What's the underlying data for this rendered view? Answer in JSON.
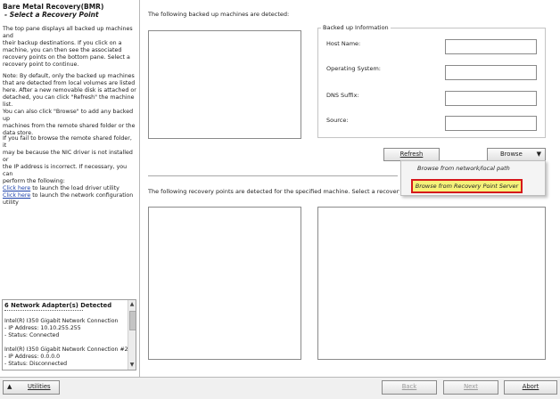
{
  "left": {
    "title": "Bare Metal Recovery(BMR)",
    "subtitle": "- Select a Recovery Point",
    "para1": [
      "The top pane displays all backed up machines and",
      "their backup destinations. If you click on a",
      "machine, you can then see the associated",
      "recovery points on the bottom pane. Select a",
      "recovery point to continue."
    ],
    "para2": [
      "Note: By default, only the backed up machines",
      "that are detected from local volumes are listed",
      "here. After a new removable disk is attached or",
      "detached, you can click \"Refresh\" the machine list.",
      "You can also click \"Browse\" to add any backed up",
      "machines from the remote shared folder or the",
      "data store."
    ],
    "para3": [
      "If you fail to browse the remote shared folder, it",
      "may be because the NIC driver is not installed or",
      "the IP address is incorrect. If necessary, you can",
      "perform the following:"
    ],
    "link1": "Click here",
    "link1_rest": " to launch the load driver utility",
    "link2": "Click here",
    "link2_rest": " to launch the network configuration",
    "link2_rest2": "utility"
  },
  "network": {
    "header": "6 Network Adapter(s) Detected",
    "lines": [
      "Intel(R) I350 Gigabit Network Connection",
      "  - IP Address: 10.10.255.255",
      "  - Status: Connected",
      "",
      "Intel(R) I350 Gigabit Network Connection #2",
      "  - IP Address: 0.0.0.0",
      "  - Status: Disconnected"
    ]
  },
  "main": {
    "machines_label": "The following backed up machines are detected:",
    "recovery_label": "The following recovery points are detected for the specified machine. Select a recovery point a",
    "info": {
      "legend": "Backed up Information",
      "host_label": "Host Name:",
      "os_label": "Operating System:",
      "dns_label": "DNS Suffix:",
      "source_label": "Source:",
      "host_value": "",
      "os_value": "",
      "dns_value": "",
      "source_value": ""
    },
    "refresh_label": "Refresh",
    "browse_label": "Browse",
    "browse_menu": [
      "Browse from network/local path",
      "Browse from Recovery Point Server"
    ],
    "highlight_color": "#f6f27a",
    "outline_color": "#d6181b"
  },
  "bottom": {
    "utilities": "Utilities",
    "back": "Back",
    "next": "Next",
    "abort": "Abort"
  }
}
